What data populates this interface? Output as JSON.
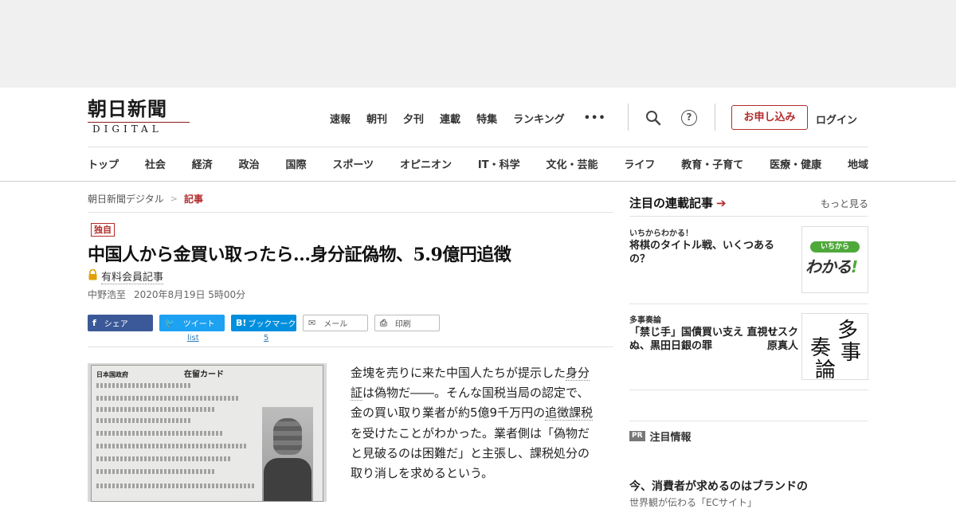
{
  "header": {
    "logo_jp": "朝日新聞",
    "logo_en": "DIGITAL",
    "top_nav": [
      "速報",
      "朝刊",
      "夕刊",
      "連載",
      "特集",
      "ランキング"
    ],
    "more_label": "•••",
    "help_label": "?",
    "subscribe_label": "お申し込み",
    "login_label": "ログイン",
    "categories": [
      "トップ",
      "社会",
      "経済",
      "政治",
      "国際",
      "スポーツ",
      "オピニオン",
      "IT・科学",
      "文化・芸能",
      "ライフ",
      "教育・子育て",
      "医療・健康",
      "地域"
    ]
  },
  "article": {
    "breadcrumb_home": "朝日新聞デジタル",
    "breadcrumb_sep": ">",
    "breadcrumb_current": "記事",
    "badge": "独自",
    "title": "中国人から金買い取ったら…身分証偽物、5.9億円追徴",
    "paid_label": "有料会員記事",
    "author": "中野浩至",
    "date": "2020年8月19日 5時00分",
    "share": {
      "facebook_glyph": "f",
      "facebook_label": "シェア",
      "twitter_glyph": "🐦",
      "twitter_label": "ツイート",
      "twitter_count": "list",
      "hatena_glyph": "B!",
      "hatena_label": "ブックマーク",
      "hatena_count": "5",
      "mail_glyph": "✉",
      "mail_label": "メール",
      "print_glyph": "⎙",
      "print_label": "印刷"
    },
    "photo": {
      "card_header": "日本国政府",
      "card_title": "在留カード"
    },
    "body": {
      "p1_a": "金塊を売りに来た中国人たちが提示した",
      "kw1": "身分証",
      "p1_b": "は偽物だ――。そんな国税当局の認定で、金の買い取り業者が約5億9千万円の",
      "kw2": "追徴課税",
      "p1_c": "を受けたことがわかった。業者側は「偽物だと見破るのは困難だ」と主張し、課税処分の取り消しを求めるという。"
    }
  },
  "sidebar": {
    "heading": "注目の連載記事",
    "heading_arrow": "➔",
    "more_label": "もっと見る",
    "items": [
      {
        "kicker": "いちからわかる！",
        "title": "将棋のタイトル戦、いくつあるの？",
        "thumb_top": "いちから",
        "thumb_main": "わかる",
        "thumb_bang": "!"
      },
      {
        "kicker": "多事奏論",
        "title": "「禁じ手」国債買い支え 直視せぬ、黒田日銀の罪",
        "author": "リスク 原真人",
        "thumb_chars": [
          "多",
          "事",
          "奏",
          "論"
        ]
      }
    ],
    "pr_tag": "PR",
    "pr_label": "注目情報",
    "pr_title": "今、消費者が求めるのはブランドの",
    "pr_sub": "世界観が伝わる「ECサイト」"
  },
  "colors": {
    "accent_red": "#b32c2c",
    "facebook": "#3b5998",
    "twitter": "#1da1f2",
    "hatena": "#008fde",
    "ichikara_green": "#4fa83a"
  }
}
